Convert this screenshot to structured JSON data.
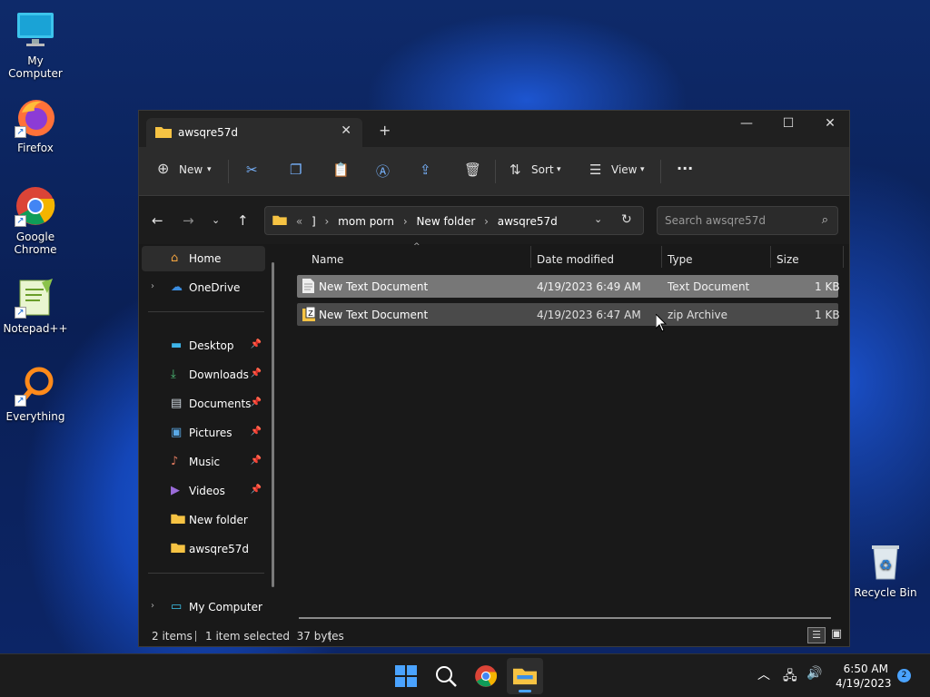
{
  "desktop": {
    "icons": [
      {
        "label": "My Computer"
      },
      {
        "label": "Firefox"
      },
      {
        "label": "Google Chrome"
      },
      {
        "label": "Notepad++"
      },
      {
        "label": "Everything"
      },
      {
        "label": "Recycle Bin"
      }
    ]
  },
  "window": {
    "tab_title": "awsqre57d",
    "toolbar": {
      "new_label": "New",
      "sort_label": "Sort",
      "view_label": "View",
      "more_label": "···"
    },
    "address": {
      "overflow": "«",
      "crumbs": [
        "]",
        "mom porn",
        "New folder",
        "awsqre57d"
      ],
      "separator": "›"
    },
    "search": {
      "placeholder": "Search awsqre57d"
    },
    "sidebar": {
      "home": "Home",
      "onedrive": "OneDrive",
      "quick": [
        "Desktop",
        "Downloads",
        "Documents",
        "Pictures",
        "Music",
        "Videos",
        "New folder",
        "awsqre57d"
      ],
      "my_computer": "My Computer"
    },
    "columns": {
      "name": "Name",
      "date": "Date modified",
      "type": "Type",
      "size": "Size"
    },
    "files": [
      {
        "name": "New Text Document",
        "date": "4/19/2023 6:49 AM",
        "type": "Text Document",
        "size": "1 KB",
        "selected": true
      },
      {
        "name": "New Text Document",
        "date": "4/19/2023 6:47 AM",
        "type": "zip Archive",
        "size": "1 KB",
        "selected": false
      }
    ],
    "status": {
      "items": "2 items",
      "selected": "1 item selected  37 bytes"
    }
  },
  "taskbar": {
    "time": "6:50 AM",
    "date": "4/19/2023",
    "notifications": "2"
  },
  "colors": {
    "selected_row": "#777777",
    "hover_row": "#4a4a4a",
    "accent": "#4aa3ff",
    "folder": "#f6c343"
  }
}
